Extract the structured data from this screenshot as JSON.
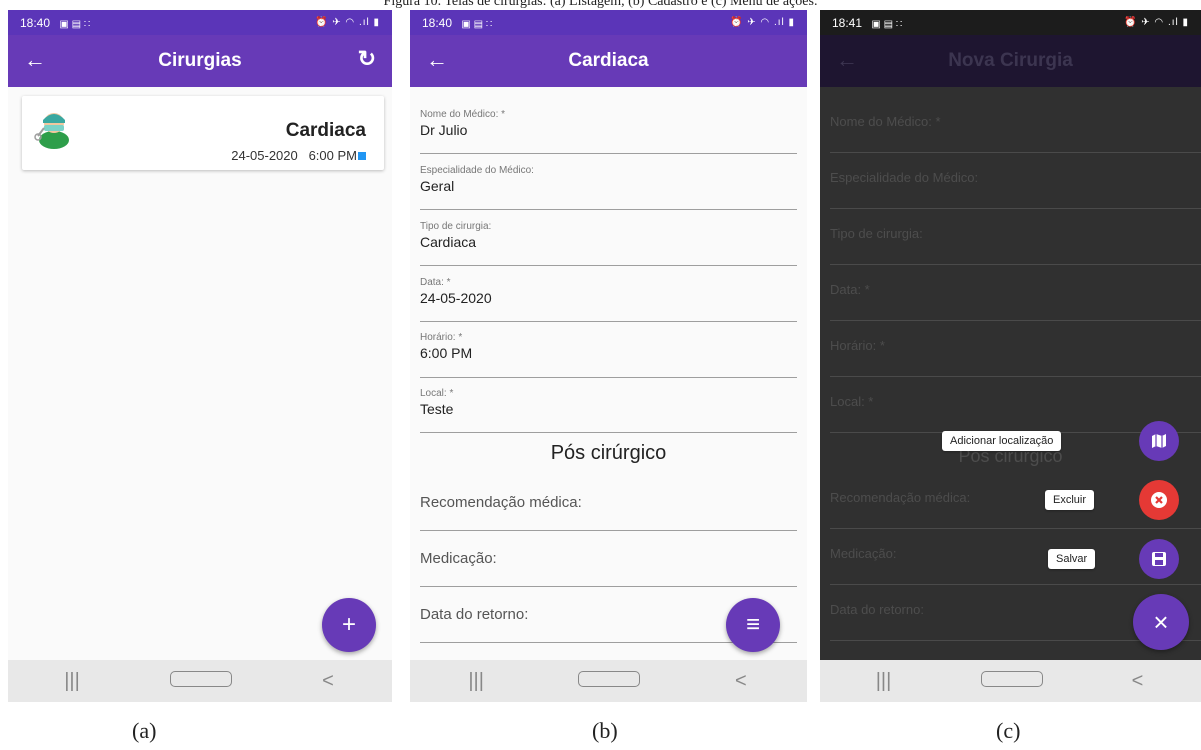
{
  "caption_top": "Figura 10. Telas de cirurgias: (a) Listagem, (b) Cadastro e (c) Menu de ações.",
  "screen_a": {
    "status_time": "18:40",
    "status_icons": "▣ ▤ ∷",
    "status_right": "⏰ ✈ ◠ .ıl ▮",
    "title": "Cirurgias",
    "item": {
      "title": "Cardiaca",
      "date": "24-05-2020",
      "time": "6:00 PM"
    },
    "fab_icon": "+"
  },
  "screen_b": {
    "status_time": "18:40",
    "status_icons": "▣ ▤ ∷",
    "status_right": "⏰ ✈ ◠ .ıl ▮",
    "title": "Cardiaca",
    "fields": [
      {
        "label": "Nome do Médico: *",
        "value": "Dr Julio"
      },
      {
        "label": "Especialidade do Médico:",
        "value": "Geral"
      },
      {
        "label": "Tipo de cirurgia:",
        "value": "Cardiaca"
      },
      {
        "label": "Data: *",
        "value": "24-05-2020"
      },
      {
        "label": "Horário: *",
        "value": "6:00 PM"
      },
      {
        "label": "Local: *",
        "value": "Teste"
      }
    ],
    "section": "Pós cirúrgico",
    "post_fields": [
      "Recomendação médica:",
      "Medicação:",
      "Data do retorno:"
    ],
    "fab_icon": "≡"
  },
  "screen_c": {
    "status_time": "18:41",
    "status_icons": "▣ ▤ ∷",
    "status_right": "⏰ ✈ ◠ .ıl ▮",
    "title": "Nova Cirurgia",
    "fields": [
      "Nome do Médico: *",
      "Especialidade do Médico:",
      "Tipo de cirurgia:",
      "Data: *",
      "Horário: *",
      "Local: *"
    ],
    "section": "Pós cirúrgico",
    "post_fields": [
      "Recomendação médica:",
      "Medicação:",
      "Data do retorno:"
    ],
    "actions": {
      "add_location": "Adicionar localização",
      "delete": "Excluir",
      "save": "Salvar",
      "close_icon": "×"
    }
  },
  "nav": {
    "recents": "|||",
    "back": "<"
  },
  "captions": [
    "(a)",
    "(b)",
    "(c)"
  ],
  "colors": {
    "primary": "#673ab7",
    "status": "#5b35b8",
    "danger": "#e53935"
  }
}
